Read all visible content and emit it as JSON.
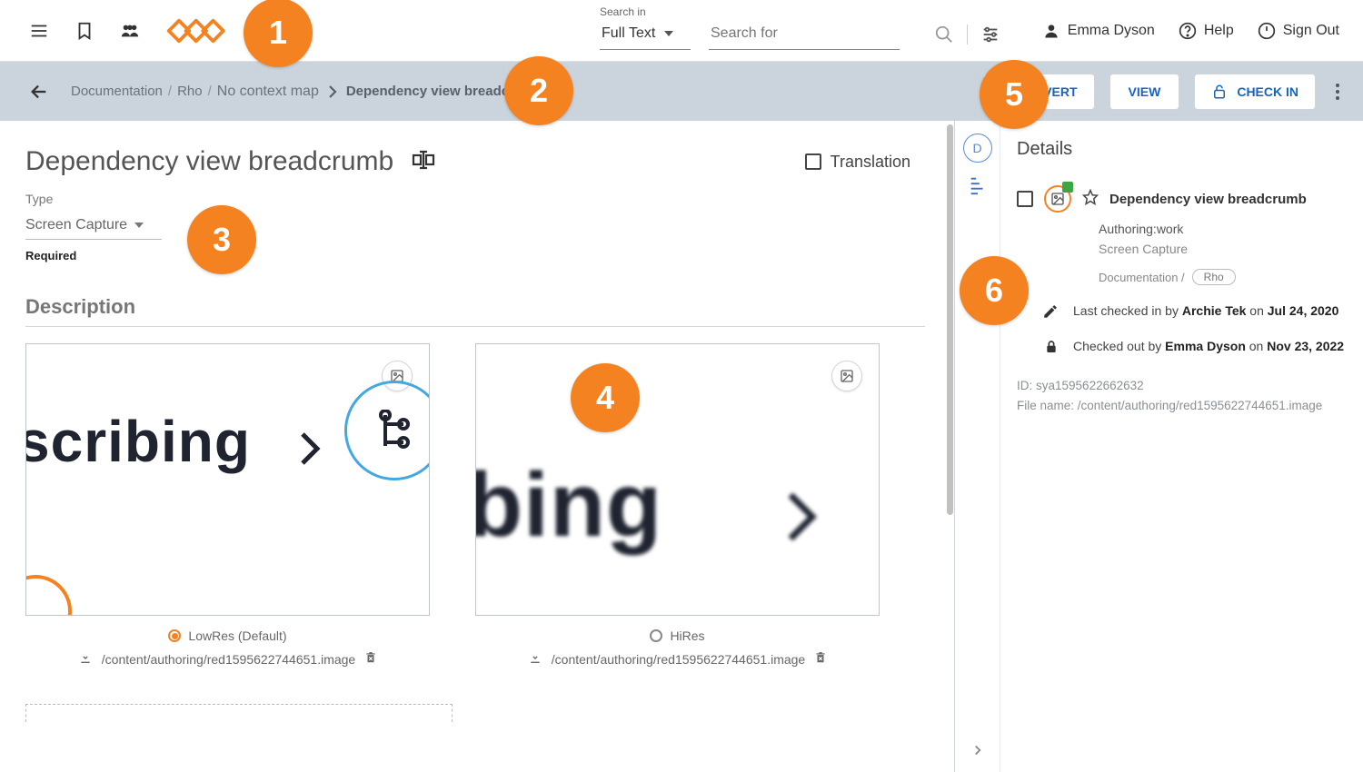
{
  "header": {
    "search_in_label": "Search in",
    "search_scope": "Full Text",
    "search_placeholder": "Search for",
    "user_name": "Emma Dyson",
    "help_label": "Help",
    "signout_label": "Sign Out"
  },
  "strip": {
    "crumb1": "Documentation",
    "crumb2": "Rho",
    "crumb3": "No context map",
    "crumb4": "Dependency view breadcrumb",
    "revert_label": "REVERT",
    "view_label": "VIEW",
    "checkin_label": "CHECK IN"
  },
  "page": {
    "title": "Dependency view breadcrumb",
    "translation_label": "Translation",
    "type_label": "Type",
    "type_value": "Screen Capture",
    "required_label": "Required",
    "description_label": "Description",
    "variants": [
      {
        "label": "LowRes (Default)",
        "path": "/content/authoring/red1595622744651.image",
        "selected": true
      },
      {
        "label": "HiRes",
        "path": "/content/authoring/red1595622744651.image",
        "selected": false
      }
    ]
  },
  "details": {
    "heading": "Details",
    "rail_letter": "D",
    "title": "Dependency view breadcrumb",
    "status": "Authoring:work",
    "type": "Screen Capture",
    "path_prefix": "Documentation /",
    "path_pill": "Rho",
    "checkin_prefix": "Last checked in by ",
    "checkin_user": "Archie Tek",
    "checkin_mid": " on ",
    "checkin_date": "Jul 24, 2020",
    "checkout_prefix": "Checked out by ",
    "checkout_user": "Emma Dyson",
    "checkout_mid": " on ",
    "checkout_date": "Nov 23, 2022",
    "id_label": "ID: ",
    "id_value": "sya1595622662632",
    "file_label": "File name: ",
    "file_value": "/content/authoring/red1595622744651.image"
  },
  "callouts": {
    "c1": "1",
    "c2": "2",
    "c3": "3",
    "c4": "4",
    "c5": "5",
    "c6": "6"
  }
}
